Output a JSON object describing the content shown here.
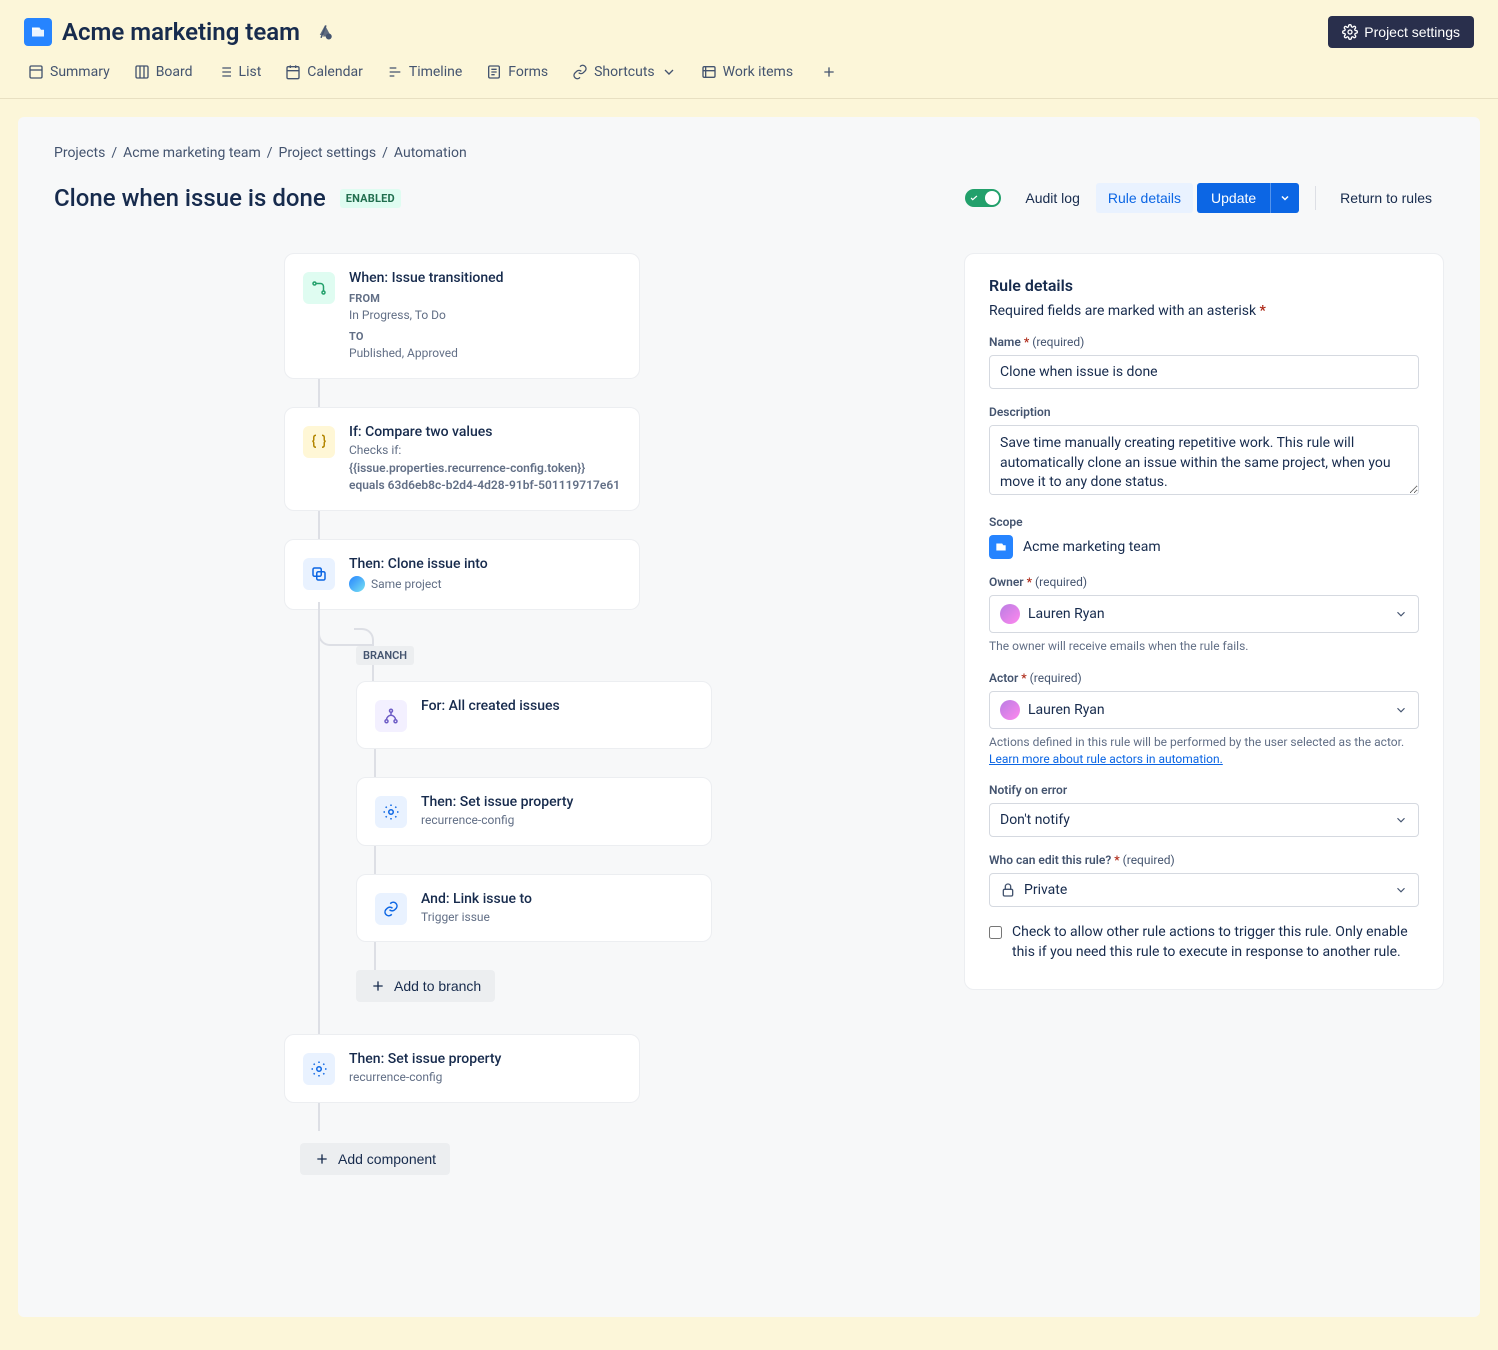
{
  "header": {
    "project_title": "Acme marketing team",
    "settings_label": "Project settings"
  },
  "nav": {
    "summary": "Summary",
    "board": "Board",
    "list": "List",
    "calendar": "Calendar",
    "timeline": "Timeline",
    "forms": "Forms",
    "shortcuts": "Shortcuts",
    "work_items": "Work items"
  },
  "breadcrumb": [
    "Projects",
    "Acme marketing team",
    "Project settings",
    "Automation"
  ],
  "rule": {
    "title": "Clone when issue is done",
    "status_badge": "ENABLED"
  },
  "actions": {
    "audit_log": "Audit log",
    "rule_details": "Rule details",
    "update": "Update",
    "return": "Return to rules"
  },
  "flow": {
    "trigger": {
      "title": "When: Issue transitioned",
      "from_label": "FROM",
      "from_value": "In Progress, To Do",
      "to_label": "TO",
      "to_value": "Published, Approved"
    },
    "condition": {
      "title": "If: Compare two values",
      "checks": "Checks if: ",
      "expr": "{{issue.properties.recurrence-config.token}} equals 63d6eb8c-b2d4-4d28-91bf-501119717e61"
    },
    "clone": {
      "title": "Then: Clone issue into",
      "sub": "Same project"
    },
    "branch_label": "BRANCH",
    "branch_for": {
      "title": "For: All created issues"
    },
    "branch_set": {
      "title": "Then: Set issue property",
      "sub": "recurrence-config"
    },
    "branch_link": {
      "title": "And: Link issue to",
      "sub": "Trigger issue"
    },
    "add_to_branch": "Add to branch",
    "last_set": {
      "title": "Then: Set issue property",
      "sub": "recurrence-config"
    },
    "add_component": "Add component"
  },
  "panel": {
    "heading": "Rule details",
    "required_hint": "Required fields are marked with an asterisk",
    "name_label": "Name",
    "required_text": "(required)",
    "name_value": "Clone when issue is done",
    "description_label": "Description",
    "description_value": "Save time manually creating repetitive work. This rule will automatically clone an issue within the same project, when you move it to any done status.",
    "scope_label": "Scope",
    "scope_value": "Acme marketing team",
    "owner_label": "Owner",
    "owner_value": "Lauren Ryan",
    "owner_help": "The owner will receive emails when the rule fails.",
    "actor_label": "Actor",
    "actor_value": "Lauren Ryan",
    "actor_help_pre": "Actions defined in this rule will be performed by the user selected as the actor. ",
    "actor_help_link": "Learn more about rule actors in automation.",
    "notify_label": "Notify on error",
    "notify_value": "Don't notify",
    "edit_label": "Who can edit this rule?",
    "edit_value": "Private",
    "checkbox_label": "Check to allow other rule actions to trigger this rule. Only enable this if you need this rule to execute in response to another rule."
  }
}
